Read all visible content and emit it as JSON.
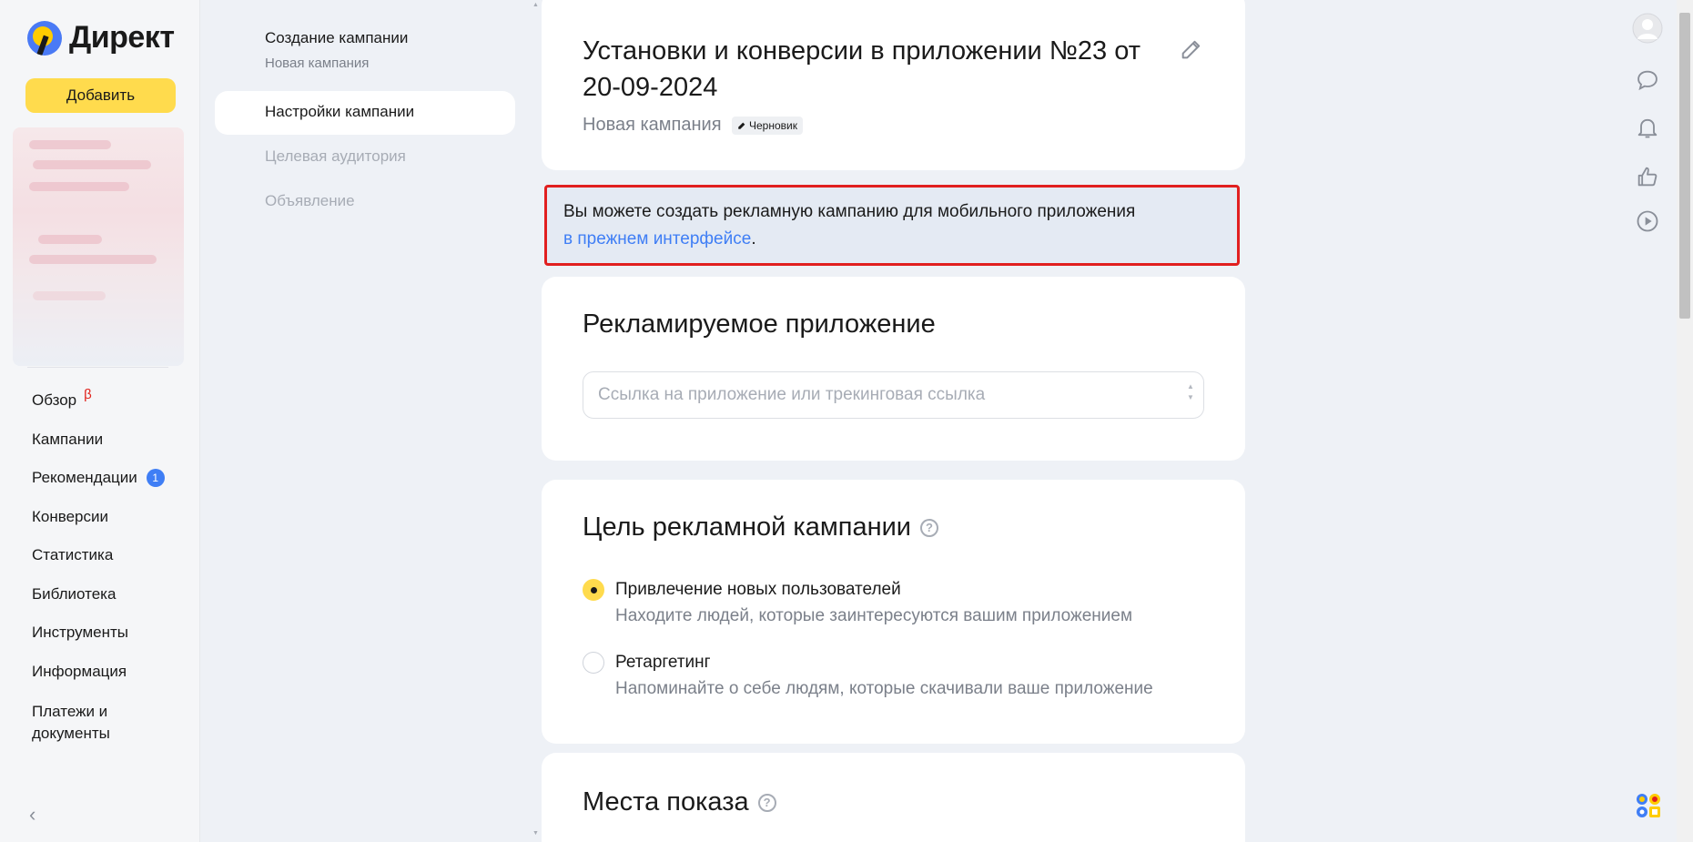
{
  "brand": {
    "name": "Директ"
  },
  "sidebar": {
    "add_button": "Добавить",
    "nav": [
      {
        "label": "Обзор",
        "beta": "β"
      },
      {
        "label": "Кампании"
      },
      {
        "label": "Рекомендации",
        "badge": "1"
      },
      {
        "label": "Конверсии"
      },
      {
        "label": "Статистика"
      },
      {
        "label": "Библиотека"
      },
      {
        "label": "Инструменты"
      },
      {
        "label": "Информация"
      },
      {
        "label": "Платежи и документы"
      }
    ],
    "collapse": "‹"
  },
  "steps": {
    "title": "Создание кампании",
    "subtitle": "Новая кампания",
    "items": [
      {
        "label": "Настройки кампании",
        "active": true
      },
      {
        "label": "Целевая аудитория"
      },
      {
        "label": "Объявление"
      }
    ]
  },
  "header": {
    "title": "Установки и конверсии в приложении №23 от 20-09-2024",
    "status": "Новая кампания",
    "draft_badge": "Черновик"
  },
  "notice": {
    "text": "Вы можете создать рекламную кампанию для мобильного приложения",
    "link": "в прежнем интерфейсе",
    "suffix": "."
  },
  "app_section": {
    "heading": "Рекламируемое приложение",
    "input_placeholder": "Ссылка на приложение или трекинговая ссылка",
    "input_value": ""
  },
  "goal_section": {
    "heading": "Цель рекламной кампании",
    "options": [
      {
        "label": "Привлечение новых пользователей",
        "description": "Находите людей, которые заинтересуются вашим приложением",
        "selected": true
      },
      {
        "label": "Ретаргетинг",
        "description": "Напоминайте о себе людям, которые скачивали ваше приложение",
        "selected": false
      }
    ]
  },
  "places_section": {
    "heading": "Места показа"
  },
  "colors": {
    "accent_yellow": "#ffdb4d",
    "link_blue": "#3f7ef5",
    "highlight_red": "#e11f1f"
  }
}
